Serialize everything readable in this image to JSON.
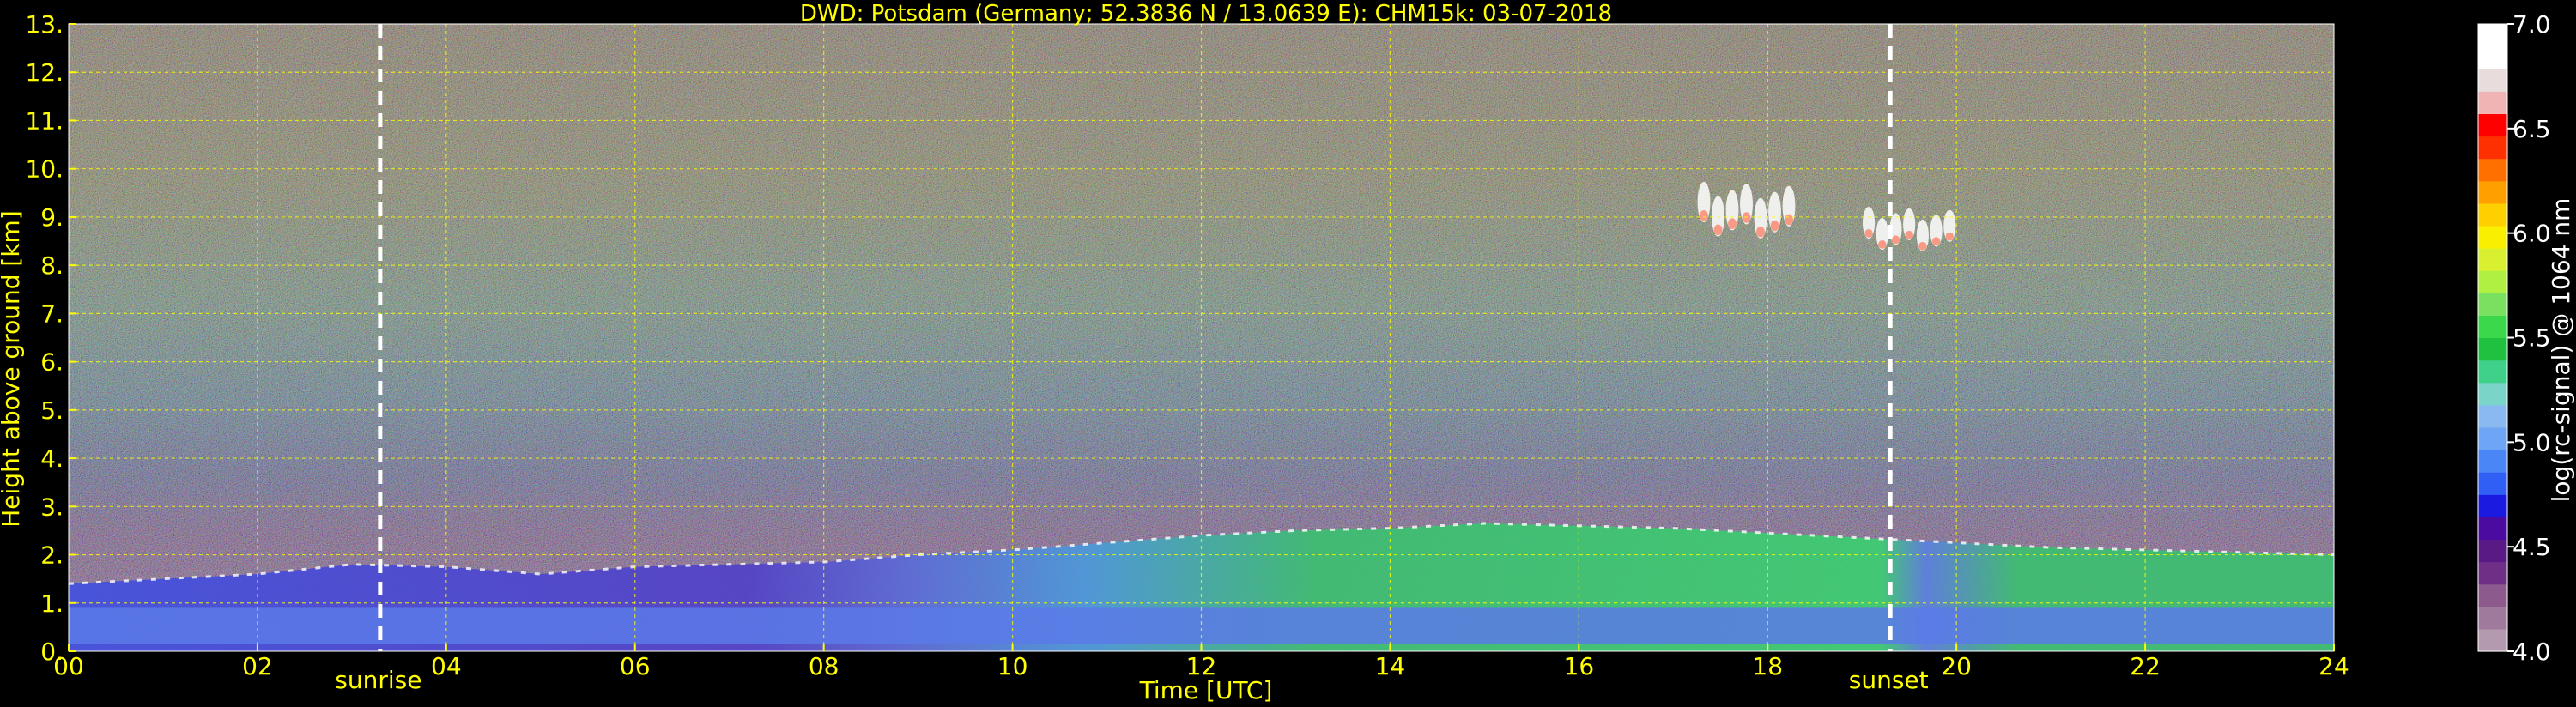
{
  "chart_data": {
    "type": "heatmap",
    "title": "DWD: Potsdam (Germany; 52.3836 N / 13.0639 E):    CHM15k: 03-07-2018",
    "xlabel": "Time [UTC]",
    "ylabel": "Height above ground [km]",
    "xlim": [
      0,
      24
    ],
    "ylim": [
      0,
      13
    ],
    "x_ticks": [
      0,
      2,
      4,
      6,
      8,
      10,
      12,
      14,
      16,
      18,
      20,
      22,
      24
    ],
    "x_tick_labels": [
      "00",
      "02",
      "04",
      "06",
      "08",
      "10",
      "12",
      "14",
      "16",
      "18",
      "20",
      "22",
      "24"
    ],
    "y_ticks": [
      0,
      1,
      2,
      3,
      4,
      5,
      6,
      7,
      8,
      9,
      10,
      11,
      12,
      13
    ],
    "y_tick_labels": [
      "0.",
      "1.",
      "2.",
      "3.",
      "4.",
      "5.",
      "6.",
      "7.",
      "8.",
      "9.",
      "10.",
      "11.",
      "12.",
      "13."
    ],
    "grid": true,
    "markers": [
      {
        "label": "sunrise",
        "x": 3.3
      },
      {
        "label": "sunset",
        "x": 19.3
      }
    ],
    "boundary_layer_top_km": [
      [
        0,
        1.4
      ],
      [
        2,
        1.6
      ],
      [
        3,
        1.8
      ],
      [
        4,
        1.75
      ],
      [
        5,
        1.6
      ],
      [
        6,
        1.75
      ],
      [
        7,
        1.8
      ],
      [
        8,
        1.85
      ],
      [
        9,
        2.0
      ],
      [
        10,
        2.1
      ],
      [
        11,
        2.25
      ],
      [
        12,
        2.4
      ],
      [
        13,
        2.5
      ],
      [
        14,
        2.55
      ],
      [
        15,
        2.65
      ],
      [
        16,
        2.6
      ],
      [
        17,
        2.55
      ],
      [
        18,
        2.45
      ],
      [
        19,
        2.35
      ],
      [
        20,
        2.25
      ],
      [
        21,
        2.15
      ],
      [
        22,
        2.1
      ],
      [
        23,
        2.05
      ],
      [
        24,
        2.0
      ]
    ],
    "cirrus_clouds": [
      {
        "x0": 17.25,
        "x1": 18.3,
        "ybottom": 8.4,
        "ytop": 9.8
      },
      {
        "x0": 19.0,
        "x1": 20.0,
        "ybottom": 8.2,
        "ytop": 9.3
      }
    ],
    "colorbar": {
      "label": "log(rc-signal) @ 1064 nm",
      "min": 4.0,
      "max": 7.0,
      "ticks": [
        4.0,
        4.5,
        5.0,
        5.5,
        6.0,
        6.5,
        7.0
      ],
      "tick_labels": [
        "4.0",
        "4.5",
        "5.0",
        "5.5",
        "6.0",
        "6.5",
        "7.0"
      ],
      "colors": [
        "#b49aae",
        "#a07a9c",
        "#8c5a8c",
        "#6f2f86",
        "#5a1a86",
        "#4b0aa0",
        "#1a1ae0",
        "#2f5ff5",
        "#4a86f5",
        "#6ea6f5",
        "#8ab8f0",
        "#7ad4c8",
        "#3fd08a",
        "#20c040",
        "#3ad84a",
        "#7ae060",
        "#b0f040",
        "#d8f030",
        "#f8f000",
        "#ffd000",
        "#ffa000",
        "#ff7000",
        "#ff3000",
        "#ff0000",
        "#f0b4b4",
        "#e8dcdc",
        "#ffffff",
        "#ffffff"
      ]
    }
  }
}
